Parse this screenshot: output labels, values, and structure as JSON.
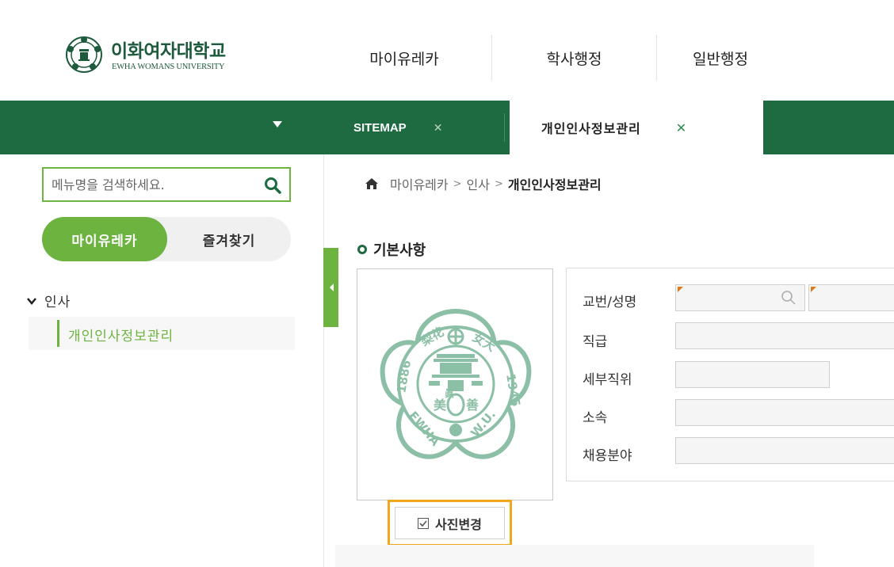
{
  "header": {
    "logo_ko": "이화여자대학교",
    "logo_en": "EWHA WOMANS UNIVERSITY",
    "nav": [
      "마이유레카",
      "학사행정",
      "일반행정"
    ]
  },
  "tabs": {
    "sitemap": "SITEMAP",
    "active": "개인인사정보관리",
    "close_glyph": "✕"
  },
  "sidebar": {
    "search_placeholder": "메뉴명을 검색하세요.",
    "toggle_on": "마이유레카",
    "toggle_off": "즐겨찾기",
    "tree_root": "인사",
    "tree_item": "개인인사정보관리"
  },
  "breadcrumb": {
    "items": [
      "마이유레카",
      "인사"
    ],
    "current": "개인인사정보관리",
    "sep": ">"
  },
  "section": {
    "title": "기본사항"
  },
  "photo": {
    "change_button": "사진변경"
  },
  "form": {
    "labels": [
      "교번/성명",
      "직급",
      "세부직위",
      "소속",
      "채용분야"
    ]
  },
  "colors": {
    "primary_green": "#1e6b42",
    "accent_green": "#6db33f",
    "highlight": "#f2a71b",
    "seal_green": "#8bbfa6"
  }
}
